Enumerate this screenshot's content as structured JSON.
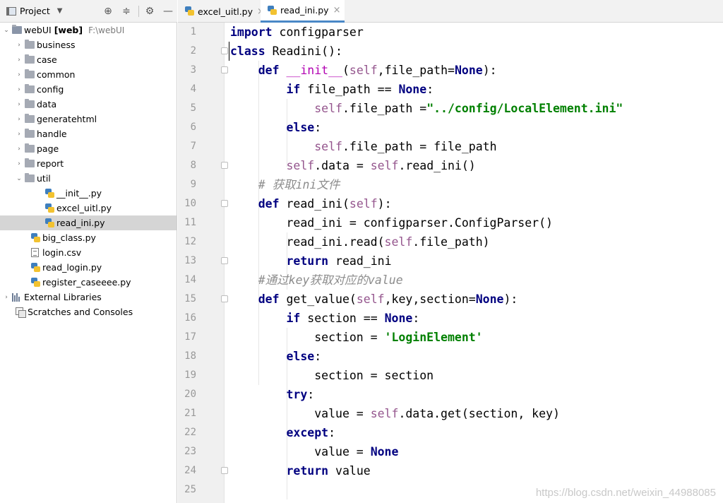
{
  "project_panel": {
    "title": "Project",
    "toolbar_icons": [
      "locate-icon",
      "collapse-icon",
      "gear-icon",
      "minimize-icon"
    ],
    "root": {
      "name": "webUI",
      "module": "[web]",
      "path": "F:\\webUI"
    },
    "items": [
      {
        "label": "business",
        "type": "folder",
        "expanded": false
      },
      {
        "label": "case",
        "type": "folder",
        "expanded": false
      },
      {
        "label": "common",
        "type": "folder",
        "expanded": false
      },
      {
        "label": "config",
        "type": "folder",
        "expanded": false
      },
      {
        "label": "data",
        "type": "folder",
        "expanded": false
      },
      {
        "label": "generatehtml",
        "type": "folder",
        "expanded": false
      },
      {
        "label": "handle",
        "type": "folder",
        "expanded": false
      },
      {
        "label": "page",
        "type": "folder",
        "expanded": false
      },
      {
        "label": "report",
        "type": "folder",
        "expanded": false
      },
      {
        "label": "util",
        "type": "folder",
        "expanded": true
      },
      {
        "label": "__init__.py",
        "type": "py",
        "indent": 2
      },
      {
        "label": "excel_uitl.py",
        "type": "py",
        "indent": 2
      },
      {
        "label": "read_ini.py",
        "type": "py",
        "indent": 2,
        "selected": true
      },
      {
        "label": "big_class.py",
        "type": "py",
        "indent": 1
      },
      {
        "label": "login.csv",
        "type": "csv",
        "indent": 1
      },
      {
        "label": "read_login.py",
        "type": "py",
        "indent": 1
      },
      {
        "label": "register_caseeee.py",
        "type": "py",
        "indent": 1
      }
    ],
    "external_libraries": "External Libraries",
    "scratches": "Scratches and Consoles"
  },
  "tabs": [
    {
      "label": "excel_uitl.py",
      "active": false
    },
    {
      "label": "read_ini.py",
      "active": true
    }
  ],
  "editor": {
    "line_numbers": [
      "1",
      "2",
      "3",
      "4",
      "5",
      "6",
      "7",
      "8",
      "9",
      "10",
      "11",
      "12",
      "13",
      "14",
      "15",
      "16",
      "17",
      "18",
      "19",
      "20",
      "21",
      "22",
      "23",
      "24",
      "25"
    ],
    "lines": [
      "import configparser",
      "class Readini():",
      "    def __init__(self,file_path=None):",
      "        if file_path == None:",
      "            self.file_path =\"../config/LocalElement.ini\"",
      "        else:",
      "            self.file_path = file_path",
      "        self.data = self.read_ini()",
      "    # 获取ini文件",
      "    def read_ini(self):",
      "        read_ini = configparser.ConfigParser()",
      "        read_ini.read(self.file_path)",
      "        return read_ini",
      "    #通过key获取对应的value",
      "    def get_value(self,key,section=None):",
      "        if section == None:",
      "            section = 'LoginElement'",
      "        else:",
      "            section = section",
      "        try:",
      "            value = self.data.get(section, key)",
      "        except:",
      "            value = None",
      "        return value",
      ""
    ]
  },
  "watermark": "https://blog.csdn.net/weixin_44988085",
  "colors": {
    "keyword": "#000080",
    "self": "#94558d",
    "string": "#008000",
    "comment": "#8c8c8c",
    "selection": "#d5d5d5",
    "tab_underline": "#4a88c7"
  }
}
